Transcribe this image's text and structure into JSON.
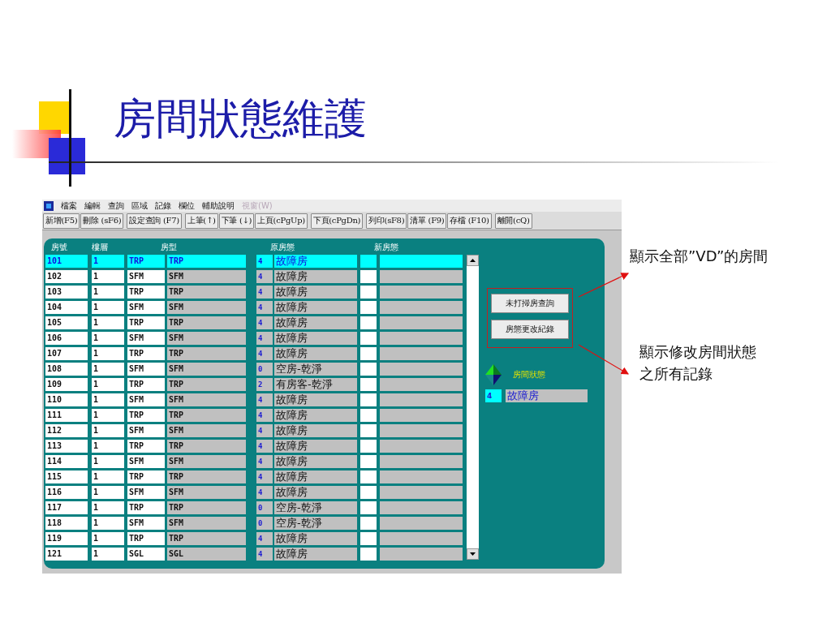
{
  "slide": {
    "title": "房間狀態維護"
  },
  "app": {
    "menu": [
      {
        "label": "檔案",
        "disabled": false
      },
      {
        "label": "編輯",
        "disabled": false
      },
      {
        "label": "查詢",
        "disabled": false
      },
      {
        "label": "區域",
        "disabled": false
      },
      {
        "label": "記錄",
        "disabled": false
      },
      {
        "label": "欄位",
        "disabled": false
      },
      {
        "label": "輔助說明",
        "disabled": false
      },
      {
        "label": "視窗(W)",
        "disabled": true
      }
    ],
    "toolbar": [
      [
        "新增(F5)",
        "刪除 (sF6)"
      ],
      [
        "設定查詢 (F7)"
      ],
      [
        "上筆(↑)",
        "下筆 (↓)",
        "上頁(cPgUp)"
      ],
      [
        "下頁(cPgDn)"
      ],
      [
        "列印(sF8)",
        "清單 (F9)",
        "存檔 (F10)"
      ],
      [
        "離開(cQ)"
      ]
    ],
    "columns": [
      "房號",
      "樓層",
      "房型",
      "原房態",
      "新房態"
    ],
    "rows": [
      {
        "room": "101",
        "floor": "1",
        "type": "TRP",
        "type_name": "TRP",
        "status": "4",
        "status_name": "故障房",
        "selected": true
      },
      {
        "room": "102",
        "floor": "1",
        "type": "SFM",
        "type_name": "SFM",
        "status": "4",
        "status_name": "故障房",
        "selected": false
      },
      {
        "room": "103",
        "floor": "1",
        "type": "TRP",
        "type_name": "TRP",
        "status": "4",
        "status_name": "故障房",
        "selected": false
      },
      {
        "room": "104",
        "floor": "1",
        "type": "SFM",
        "type_name": "SFM",
        "status": "4",
        "status_name": "故障房",
        "selected": false
      },
      {
        "room": "105",
        "floor": "1",
        "type": "TRP",
        "type_name": "TRP",
        "status": "4",
        "status_name": "故障房",
        "selected": false
      },
      {
        "room": "106",
        "floor": "1",
        "type": "SFM",
        "type_name": "SFM",
        "status": "4",
        "status_name": "故障房",
        "selected": false
      },
      {
        "room": "107",
        "floor": "1",
        "type": "TRP",
        "type_name": "TRP",
        "status": "4",
        "status_name": "故障房",
        "selected": false
      },
      {
        "room": "108",
        "floor": "1",
        "type": "SFM",
        "type_name": "SFM",
        "status": "0",
        "status_name": "空房-乾淨",
        "selected": false
      },
      {
        "room": "109",
        "floor": "1",
        "type": "TRP",
        "type_name": "TRP",
        "status": "2",
        "status_name": "有房客-乾淨",
        "selected": false
      },
      {
        "room": "110",
        "floor": "1",
        "type": "SFM",
        "type_name": "SFM",
        "status": "4",
        "status_name": "故障房",
        "selected": false
      },
      {
        "room": "111",
        "floor": "1",
        "type": "TRP",
        "type_name": "TRP",
        "status": "4",
        "status_name": "故障房",
        "selected": false
      },
      {
        "room": "112",
        "floor": "1",
        "type": "SFM",
        "type_name": "SFM",
        "status": "4",
        "status_name": "故障房",
        "selected": false
      },
      {
        "room": "113",
        "floor": "1",
        "type": "TRP",
        "type_name": "TRP",
        "status": "4",
        "status_name": "故障房",
        "selected": false
      },
      {
        "room": "114",
        "floor": "1",
        "type": "SFM",
        "type_name": "SFM",
        "status": "4",
        "status_name": "故障房",
        "selected": false
      },
      {
        "room": "115",
        "floor": "1",
        "type": "TRP",
        "type_name": "TRP",
        "status": "4",
        "status_name": "故障房",
        "selected": false
      },
      {
        "room": "116",
        "floor": "1",
        "type": "SFM",
        "type_name": "SFM",
        "status": "4",
        "status_name": "故障房",
        "selected": false
      },
      {
        "room": "117",
        "floor": "1",
        "type": "TRP",
        "type_name": "TRP",
        "status": "0",
        "status_name": "空房-乾淨",
        "selected": false
      },
      {
        "room": "118",
        "floor": "1",
        "type": "SFM",
        "type_name": "SFM",
        "status": "0",
        "status_name": "空房-乾淨",
        "selected": false
      },
      {
        "room": "119",
        "floor": "1",
        "type": "TRP",
        "type_name": "TRP",
        "status": "4",
        "status_name": "故障房",
        "selected": false
      },
      {
        "room": "121",
        "floor": "1",
        "type": "SGL",
        "type_name": "SGL",
        "status": "4",
        "status_name": "故障房",
        "selected": false
      }
    ],
    "side_buttons": [
      "未打掃房查詢",
      "房態更改紀錄"
    ],
    "legend": {
      "label": "房間狀態",
      "code": "4",
      "value": "故障房"
    }
  },
  "annotations": [
    "顯示全部”VD”的房間",
    "顯示修改房間狀態之所有記錄"
  ]
}
